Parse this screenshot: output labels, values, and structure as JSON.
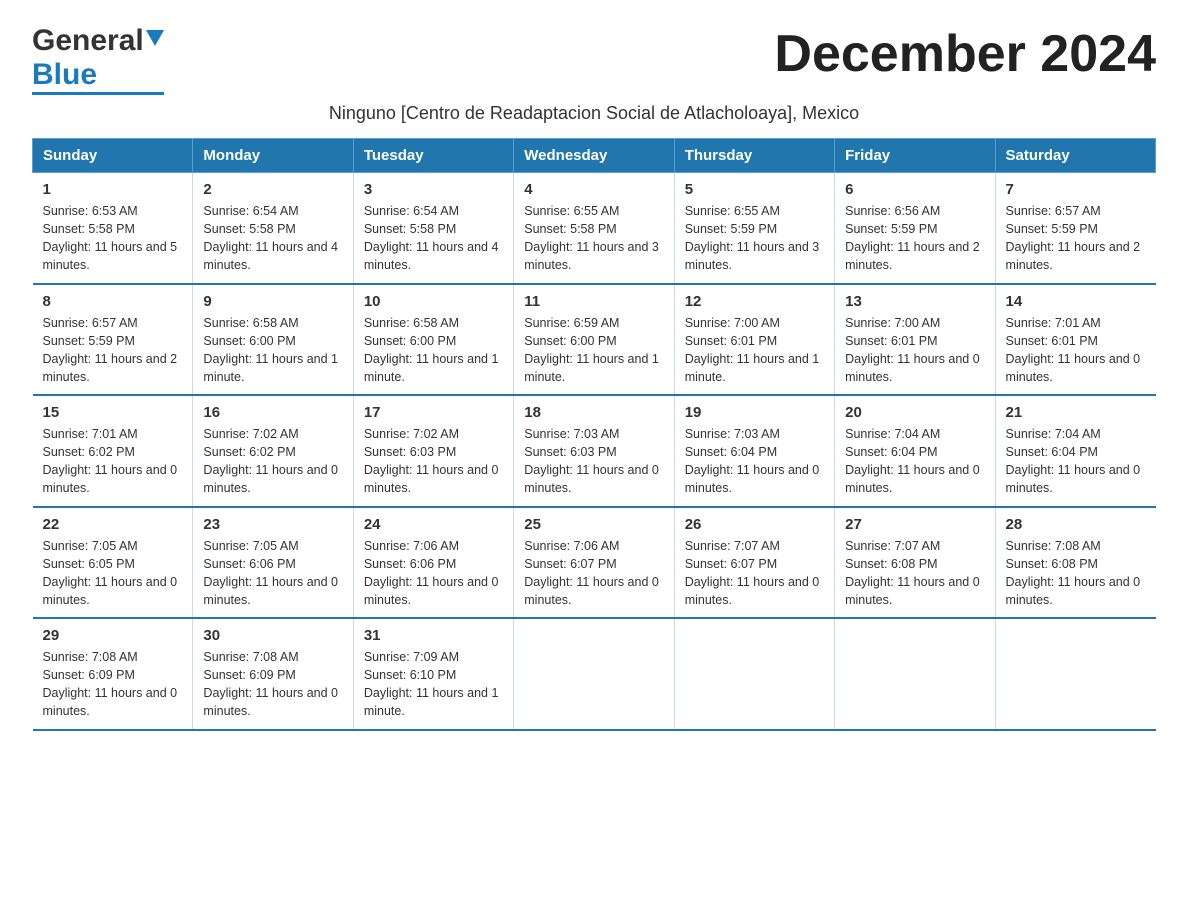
{
  "header": {
    "logo_line1": "General",
    "logo_line2": "Blue",
    "title": "December 2024",
    "subtitle": "Ninguno [Centro de Readaptacion Social de Atlacholoaya], Mexico"
  },
  "days_of_week": [
    "Sunday",
    "Monday",
    "Tuesday",
    "Wednesday",
    "Thursday",
    "Friday",
    "Saturday"
  ],
  "weeks": [
    [
      {
        "num": "1",
        "sunrise": "6:53 AM",
        "sunset": "5:58 PM",
        "daylight": "11 hours and 5 minutes."
      },
      {
        "num": "2",
        "sunrise": "6:54 AM",
        "sunset": "5:58 PM",
        "daylight": "11 hours and 4 minutes."
      },
      {
        "num": "3",
        "sunrise": "6:54 AM",
        "sunset": "5:58 PM",
        "daylight": "11 hours and 4 minutes."
      },
      {
        "num": "4",
        "sunrise": "6:55 AM",
        "sunset": "5:58 PM",
        "daylight": "11 hours and 3 minutes."
      },
      {
        "num": "5",
        "sunrise": "6:55 AM",
        "sunset": "5:59 PM",
        "daylight": "11 hours and 3 minutes."
      },
      {
        "num": "6",
        "sunrise": "6:56 AM",
        "sunset": "5:59 PM",
        "daylight": "11 hours and 2 minutes."
      },
      {
        "num": "7",
        "sunrise": "6:57 AM",
        "sunset": "5:59 PM",
        "daylight": "11 hours and 2 minutes."
      }
    ],
    [
      {
        "num": "8",
        "sunrise": "6:57 AM",
        "sunset": "5:59 PM",
        "daylight": "11 hours and 2 minutes."
      },
      {
        "num": "9",
        "sunrise": "6:58 AM",
        "sunset": "6:00 PM",
        "daylight": "11 hours and 1 minute."
      },
      {
        "num": "10",
        "sunrise": "6:58 AM",
        "sunset": "6:00 PM",
        "daylight": "11 hours and 1 minute."
      },
      {
        "num": "11",
        "sunrise": "6:59 AM",
        "sunset": "6:00 PM",
        "daylight": "11 hours and 1 minute."
      },
      {
        "num": "12",
        "sunrise": "7:00 AM",
        "sunset": "6:01 PM",
        "daylight": "11 hours and 1 minute."
      },
      {
        "num": "13",
        "sunrise": "7:00 AM",
        "sunset": "6:01 PM",
        "daylight": "11 hours and 0 minutes."
      },
      {
        "num": "14",
        "sunrise": "7:01 AM",
        "sunset": "6:01 PM",
        "daylight": "11 hours and 0 minutes."
      }
    ],
    [
      {
        "num": "15",
        "sunrise": "7:01 AM",
        "sunset": "6:02 PM",
        "daylight": "11 hours and 0 minutes."
      },
      {
        "num": "16",
        "sunrise": "7:02 AM",
        "sunset": "6:02 PM",
        "daylight": "11 hours and 0 minutes."
      },
      {
        "num": "17",
        "sunrise": "7:02 AM",
        "sunset": "6:03 PM",
        "daylight": "11 hours and 0 minutes."
      },
      {
        "num": "18",
        "sunrise": "7:03 AM",
        "sunset": "6:03 PM",
        "daylight": "11 hours and 0 minutes."
      },
      {
        "num": "19",
        "sunrise": "7:03 AM",
        "sunset": "6:04 PM",
        "daylight": "11 hours and 0 minutes."
      },
      {
        "num": "20",
        "sunrise": "7:04 AM",
        "sunset": "6:04 PM",
        "daylight": "11 hours and 0 minutes."
      },
      {
        "num": "21",
        "sunrise": "7:04 AM",
        "sunset": "6:04 PM",
        "daylight": "11 hours and 0 minutes."
      }
    ],
    [
      {
        "num": "22",
        "sunrise": "7:05 AM",
        "sunset": "6:05 PM",
        "daylight": "11 hours and 0 minutes."
      },
      {
        "num": "23",
        "sunrise": "7:05 AM",
        "sunset": "6:06 PM",
        "daylight": "11 hours and 0 minutes."
      },
      {
        "num": "24",
        "sunrise": "7:06 AM",
        "sunset": "6:06 PM",
        "daylight": "11 hours and 0 minutes."
      },
      {
        "num": "25",
        "sunrise": "7:06 AM",
        "sunset": "6:07 PM",
        "daylight": "11 hours and 0 minutes."
      },
      {
        "num": "26",
        "sunrise": "7:07 AM",
        "sunset": "6:07 PM",
        "daylight": "11 hours and 0 minutes."
      },
      {
        "num": "27",
        "sunrise": "7:07 AM",
        "sunset": "6:08 PM",
        "daylight": "11 hours and 0 minutes."
      },
      {
        "num": "28",
        "sunrise": "7:08 AM",
        "sunset": "6:08 PM",
        "daylight": "11 hours and 0 minutes."
      }
    ],
    [
      {
        "num": "29",
        "sunrise": "7:08 AM",
        "sunset": "6:09 PM",
        "daylight": "11 hours and 0 minutes."
      },
      {
        "num": "30",
        "sunrise": "7:08 AM",
        "sunset": "6:09 PM",
        "daylight": "11 hours and 0 minutes."
      },
      {
        "num": "31",
        "sunrise": "7:09 AM",
        "sunset": "6:10 PM",
        "daylight": "11 hours and 1 minute."
      },
      null,
      null,
      null,
      null
    ]
  ]
}
